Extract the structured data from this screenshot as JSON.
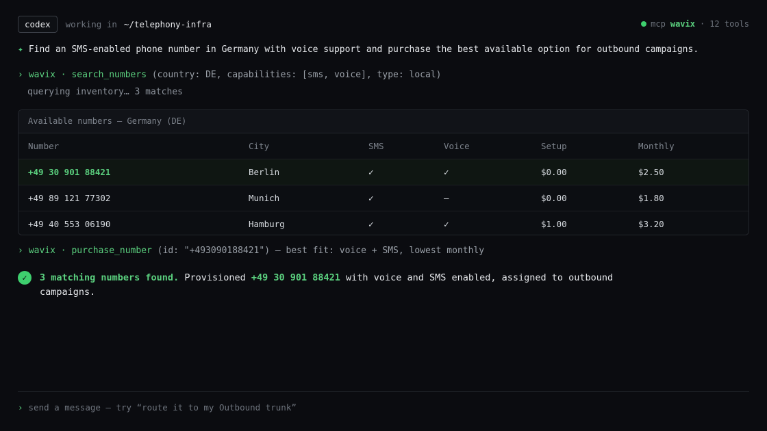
{
  "header": {
    "badge": "codex",
    "working_label": "working in",
    "working_path": "~/telephony-infra",
    "mcp_label": "mcp",
    "mcp_name": "wavix",
    "mcp_sep": "·",
    "tools": "12 tools",
    "status_color": "#3ecf6e"
  },
  "prompt": {
    "icon": "diamond-icon",
    "text": "Find an SMS-enabled phone number in Germany with voice support and purchase the best available option for outbound campaigns."
  },
  "call1": {
    "caret": "›",
    "fn": "wavix · search_numbers",
    "args": " (country: DE, capabilities: [sms, voice], type: local)",
    "status": "querying inventory… 3 matches"
  },
  "table": {
    "caption": "Available numbers — Germany (DE)",
    "headers": [
      "Number",
      "City",
      "SMS",
      "Voice",
      "Setup",
      "Monthly"
    ],
    "rows": [
      [
        "+49 30 901 88421",
        "Berlin",
        "✓",
        "✓",
        "$0.00",
        "$2.50"
      ],
      [
        "+49 89 121 77302",
        "Munich",
        "✓",
        "—",
        "$0.00",
        "$1.80"
      ],
      [
        "+49 40 553 06190",
        "Hamburg",
        "✓",
        "✓",
        "$1.00",
        "$3.20"
      ]
    ]
  },
  "call2": {
    "caret": "›",
    "fn": "wavix · purchase_number",
    "args": " (id: \"+493090188421\") — best fit: voice + SMS, lowest monthly"
  },
  "result": {
    "check": "✓",
    "bold1": "3 matching numbers found.",
    "t1": " Provisioned ",
    "bold2": "+49 30 901 88421",
    "t2": " with voice and SMS enabled, assigned to outbound campaigns."
  },
  "input": {
    "caret": "›",
    "placeholder": "send a message — try “route it to my Outbound trunk”"
  },
  "colors": {
    "accent": "#5bd17f",
    "background": "#0b0c10"
  }
}
